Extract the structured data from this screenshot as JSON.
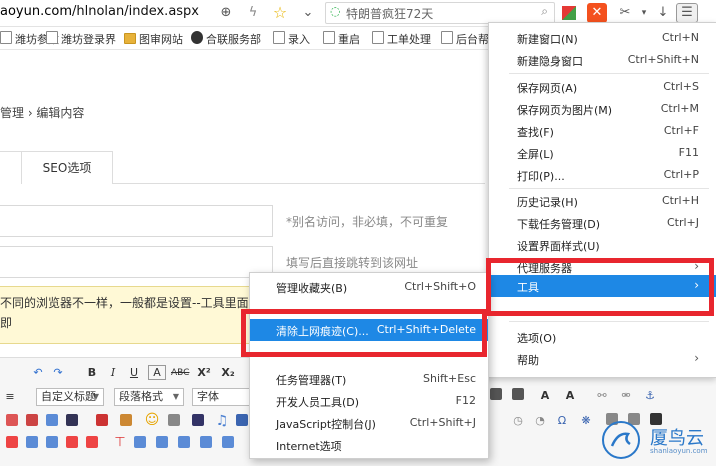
{
  "browser": {
    "url_host": "aoyun.com",
    "url_path": "/hlnolan/index.aspx",
    "search_text": "特朗普疯狂72天",
    "colors": {
      "menu_highlight": "#1e88e5",
      "annotation_red": "#e8262e"
    }
  },
  "bookmarks": [
    {
      "label": "潍坊参数",
      "icon": "page-icon"
    },
    {
      "label": "潍坊登录界",
      "icon": "page-icon"
    },
    {
      "label": "图审网站",
      "icon": "folder-icon"
    },
    {
      "label": "合联服务部",
      "icon": "logo-icon"
    },
    {
      "label": "录入",
      "icon": "page-icon"
    },
    {
      "label": "重启",
      "icon": "page-icon"
    },
    {
      "label": "工单处理",
      "icon": "page-icon"
    },
    {
      "label": "后台帮助",
      "icon": "page-icon"
    }
  ],
  "page": {
    "breadcrumb": "管理 › 编辑内容",
    "tab_seo": "SEO选项",
    "hint_alias": "*别名访问，非必填，不可重复",
    "hint_redirect": "填写后直接跳转到该网址",
    "note_line1": "不同的浏览器不一样，一般都是设置--工具里面进行",
    "note_line2": "即"
  },
  "editor": {
    "select_title": "自定义标题",
    "select_paragraph": "段落格式",
    "select_font": "字体"
  },
  "main_menu": {
    "items": [
      {
        "label": "新建窗口(N)",
        "shortcut": "Ctrl+N"
      },
      {
        "label": "新建隐身窗口",
        "shortcut": "Ctrl+Shift+N"
      },
      {
        "label": "保存网页(A)",
        "shortcut": "Ctrl+S"
      },
      {
        "label": "保存网页为图片(M)",
        "shortcut": "Ctrl+M"
      },
      {
        "label": "查找(F)",
        "shortcut": "Ctrl+F"
      },
      {
        "label": "全屏(L)",
        "shortcut": "F11"
      },
      {
        "label": "打印(P)...",
        "shortcut": "Ctrl+P"
      },
      {
        "label": "历史记录(H)",
        "shortcut": "Ctrl+H"
      },
      {
        "label": "下载任务管理(D)",
        "shortcut": "Ctrl+J"
      },
      {
        "label": "设置界面样式(U)",
        "shortcut": ""
      },
      {
        "label": "代理服务器",
        "shortcut": ""
      },
      {
        "label": "工具",
        "shortcut": ""
      },
      {
        "label": "选项(O)",
        "shortcut": ""
      },
      {
        "label": "帮助",
        "shortcut": ""
      }
    ]
  },
  "tools_submenu": {
    "items": [
      {
        "label": "管理收藏夹(B)",
        "shortcut": "Ctrl+Shift+O"
      },
      {
        "label": "清除上网痕迹(C)...",
        "shortcut": "Ctrl+Shift+Delete"
      },
      {
        "label": "任务管理器(T)",
        "shortcut": "Shift+Esc"
      },
      {
        "label": "开发人员工具(D)",
        "shortcut": "F12"
      },
      {
        "label": "JavaScript控制台(J)",
        "shortcut": "Ctrl+Shift+J"
      },
      {
        "label": "Internet选项",
        "shortcut": ""
      }
    ]
  },
  "watermark": {
    "text": "厦鸟云",
    "sub": "shanlaoyun.com"
  }
}
